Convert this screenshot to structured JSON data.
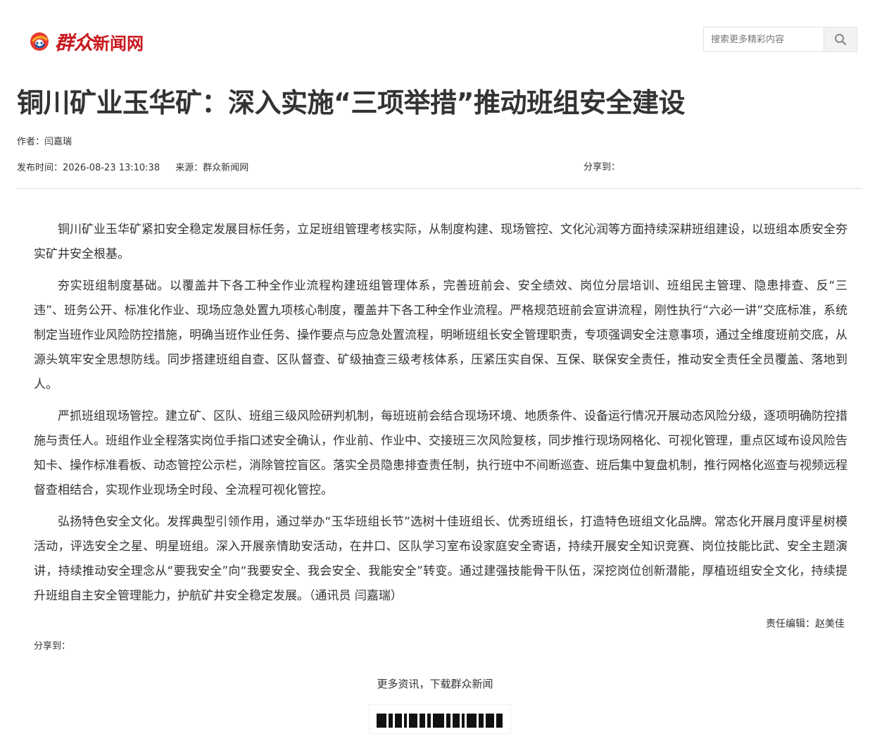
{
  "site": {
    "logo_main": "群众",
    "logo_suffix": "新闻网"
  },
  "search": {
    "placeholder": "搜索更多精彩内容",
    "icon": "search-icon"
  },
  "article": {
    "title": "铜川矿业玉华矿：深入实施“三项举措”推动班组安全建设",
    "author_label": "作者：",
    "author": "闫嘉瑞",
    "publish_label": "发布时间：",
    "publish_time": "2026-08-23 13:10:38",
    "source_label": "来源：",
    "source": "群众新闻网",
    "share_label": "分享到：",
    "paragraphs": [
      "铜川矿业玉华矿紧扣安全稳定发展目标任务，立足班组管理考核实际，从制度构建、现场管控、文化沁润等方面持续深耕班组建设，以班组本质安全夯实矿井安全根基。",
      "夯实班组制度基础。以覆盖井下各工种全作业流程构建班组管理体系，完善班前会、安全绩效、岗位分层培训、班组民主管理、隐患排查、反“三违”、班务公开、标准化作业、现场应急处置九项核心制度，覆盖井下各工种全作业流程。严格规范班前会宣讲流程，刚性执行“六必一讲”交底标准，系统制定当班作业风险防控措施，明确当班作业任务、操作要点与应急处置流程，明晰班组长安全管理职责，专项强调安全注意事项，通过全维度班前交底，从源头筑牢安全思想防线。同步搭建班组自查、区队督查、矿级抽查三级考核体系，压紧压实自保、互保、联保安全责任，推动安全责任全员覆盖、落地到人。",
      "严抓班组现场管控。建立矿、区队、班组三级风险研判机制，每班班前会结合现场环境、地质条件、设备运行情况开展动态风险分级，逐项明确防控措施与责任人。班组作业全程落实岗位手指口述安全确认，作业前、作业中、交接班三次风险复核，同步推行现场网格化、可视化管理，重点区域布设风险告知卡、操作标准看板、动态管控公示栏，消除管控盲区。落实全员隐患排查责任制，执行班中不间断巡查、班后集中复盘机制，推行网格化巡查与视频远程督查相结合，实现作业现场全时段、全流程可视化管控。",
      "弘扬特色安全文化。发挥典型引领作用，通过举办“玉华班组长节”选树十佳班组长、优秀班组长，打造特色班组文化品牌。常态化开展月度评星树模活动，评选安全之星、明星班组。深入开展亲情助安活动，在井口、区队学习室布设家庭安全寄语，持续开展安全知识竞赛、岗位技能比武、安全主题演讲，持续推动安全理念从“要我安全”向“我要安全、我会安全、我能安全”转变。通过建强技能骨干队伍，深挖岗位创新潜能，厚植班组安全文化，持续提升班组自主安全管理能力，护航矿井安全稳定发展。（通讯员 闫嘉瑞）"
    ],
    "editor_label": "责任编辑：",
    "editor": "赵美佳",
    "bottom_share_label": "分享到：",
    "more_news": "更多资讯，下载群众新闻"
  },
  "colors": {
    "brand": "#c8161d",
    "text": "#333333",
    "divider": "#e0e0e0"
  }
}
